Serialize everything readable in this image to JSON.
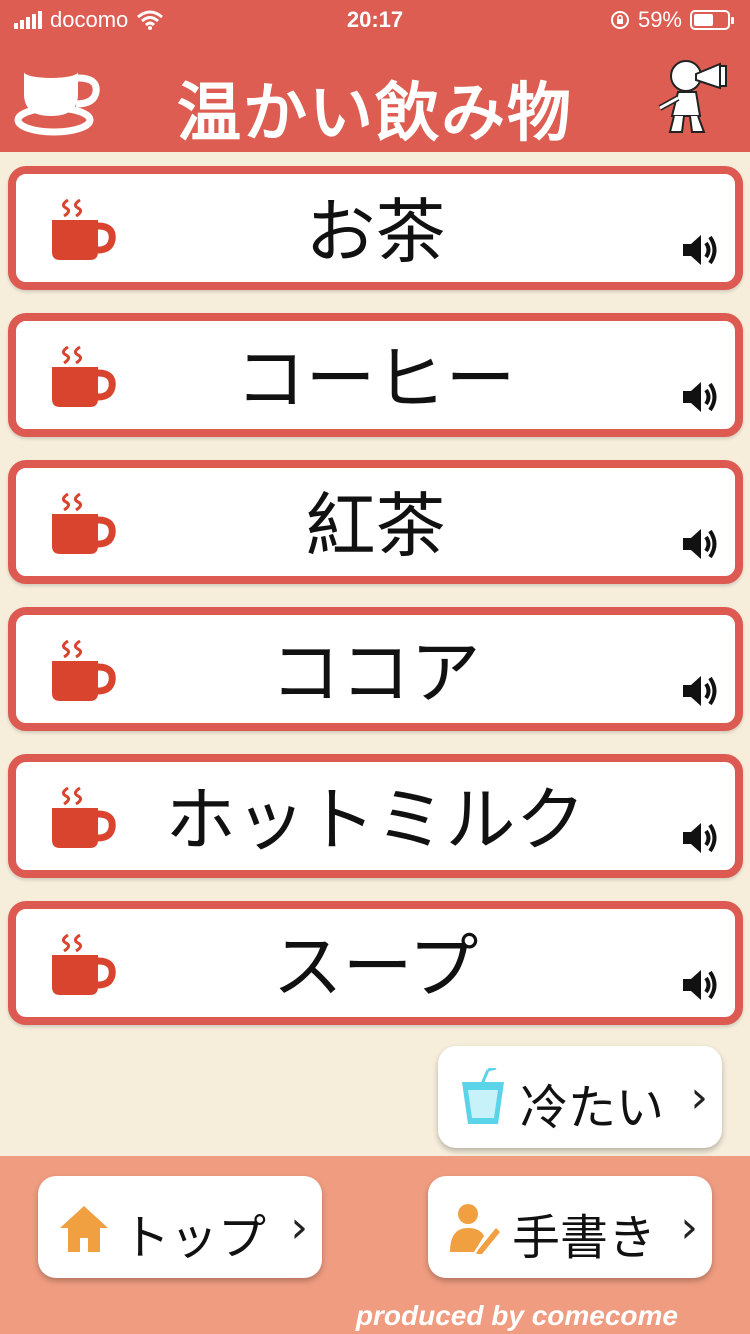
{
  "status_bar": {
    "carrier": "docomo",
    "time": "20:17",
    "battery_percent_text": "59%",
    "battery_level": 0.59
  },
  "header": {
    "title": "温かい飲み物",
    "logo_icon": "coffee-cup-icon",
    "mascot_icon": "mascot-with-horn-icon"
  },
  "items": [
    {
      "label": "お茶",
      "icon": "hot-mug-icon",
      "audio_icon": "speaker-icon"
    },
    {
      "label": "コーヒー",
      "icon": "hot-mug-icon",
      "audio_icon": "speaker-icon"
    },
    {
      "label": "紅茶",
      "icon": "hot-mug-icon",
      "audio_icon": "speaker-icon"
    },
    {
      "label": "ココア",
      "icon": "hot-mug-icon",
      "audio_icon": "speaker-icon"
    },
    {
      "label": "ホットミルク",
      "icon": "hot-mug-icon",
      "audio_icon": "speaker-icon"
    },
    {
      "label": "スープ",
      "icon": "hot-mug-icon",
      "audio_icon": "speaker-icon"
    }
  ],
  "cold_button": {
    "label": "冷たい",
    "chevron": "›",
    "icon": "cold-drink-icon"
  },
  "bottom_nav": {
    "top_button": {
      "label": "トップ",
      "chevron": "›",
      "icon": "home-icon"
    },
    "handwriting_button": {
      "label": "手書き",
      "chevron": "›",
      "icon": "person-pen-icon"
    }
  },
  "footer": {
    "credit": "produced by comecome"
  },
  "colors": {
    "header_red": "#de5d52",
    "background_cream": "#f6eddb",
    "mug_red": "#d9442f",
    "bottom_bar": "#ef9c80",
    "home_orange": "#f0a040",
    "glass_cyan": "#5bd3e8"
  }
}
